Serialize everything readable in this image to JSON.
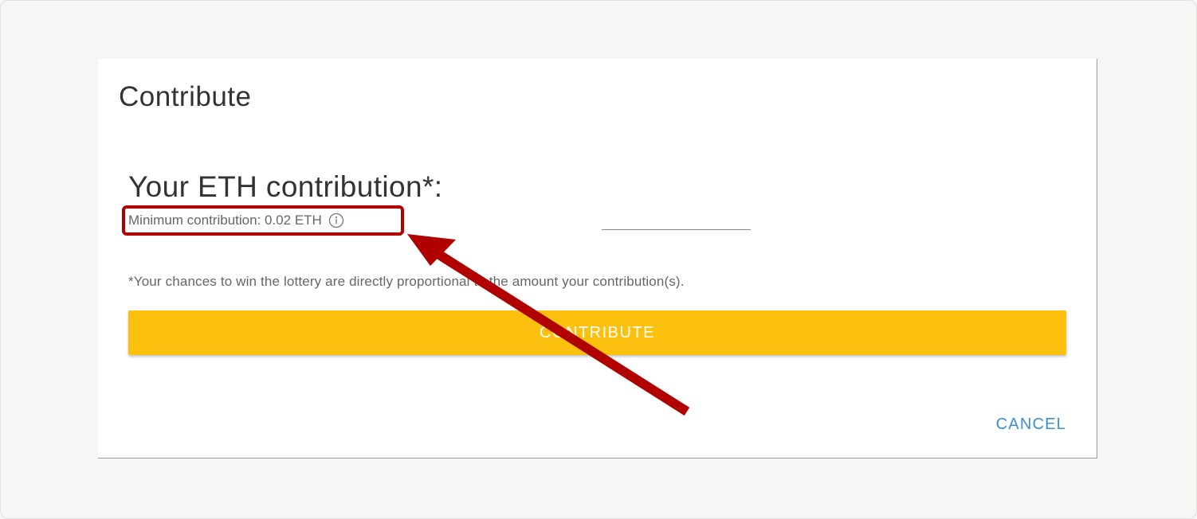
{
  "dialog": {
    "title": "Contribute",
    "field_label": "Your ETH contribution*:",
    "minimum_text": "Minimum contribution: 0.02 ETH",
    "amount_value": "",
    "note": "*Your chances to win the lottery are directly proportional to the amount your contribution(s).",
    "contribute_label": "CONTRIBUTE",
    "cancel_label": "CANCEL"
  },
  "colors": {
    "accent_button": "#fbc10e",
    "cancel_link": "#3a8fd8",
    "annotation": "#b00000"
  },
  "icons": {
    "info": "info-icon",
    "annotation_arrow": "arrow-icon"
  }
}
